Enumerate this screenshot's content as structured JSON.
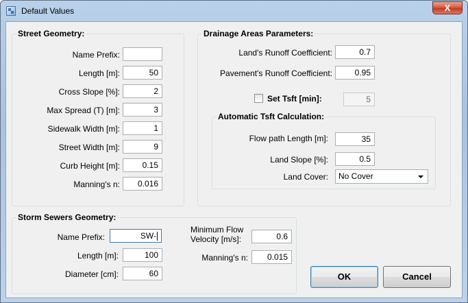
{
  "window": {
    "title": "Default Values",
    "close_label": "X"
  },
  "street_geometry": {
    "title": "Street Geometry:",
    "fields": [
      {
        "label": "Name Prefix:",
        "value": ""
      },
      {
        "label": "Length [m]:",
        "value": "50"
      },
      {
        "label": "Cross Slope [%]:",
        "value": "2"
      },
      {
        "label": "Max Spread (T) [m]:",
        "value": "3"
      },
      {
        "label": "Sidewalk Width [m]:",
        "value": "1"
      },
      {
        "label": "Street Width [m]:",
        "value": "9"
      },
      {
        "label": "Curb Height [m]:",
        "value": "0.15"
      },
      {
        "label": "Manning's n:",
        "value": "0.016"
      }
    ]
  },
  "drainage": {
    "title": "Drainage Areas Parameters:",
    "land_runoff": {
      "label": "Land's Runoff Coefficient:",
      "value": "0.7"
    },
    "pavement_runoff": {
      "label": "Pavement's Runoff Coefficient:",
      "value": "0.95"
    },
    "set_tsft": {
      "label": "Set Tsft [min]:",
      "checked": false,
      "value": "5"
    },
    "automatic": {
      "title": "Automatic Tsft Calculation:",
      "flow_path": {
        "label": "Flow path Length [m]:",
        "value": "35"
      },
      "land_slope": {
        "label": "Land Slope [%]:",
        "value": "0.5"
      },
      "land_cover": {
        "label": "Land Cover:",
        "selected": "No Cover"
      }
    }
  },
  "storm_sewers": {
    "title": "Storm Sewers Geometry:",
    "name_prefix": {
      "label": "Name Prefix:",
      "value": "SW-"
    },
    "length": {
      "label": "Length [m]:",
      "value": "100"
    },
    "diameter": {
      "label": "Diameter [cm]:",
      "value": "60"
    },
    "min_flow_velocity": {
      "label_line1": "Minimum Flow",
      "label_line2": "Velocity [m/s]:",
      "value": "0.6"
    },
    "mannings_n": {
      "label": "Manning's n:",
      "value": "0.015"
    }
  },
  "buttons": {
    "ok": "OK",
    "cancel": "Cancel"
  }
}
